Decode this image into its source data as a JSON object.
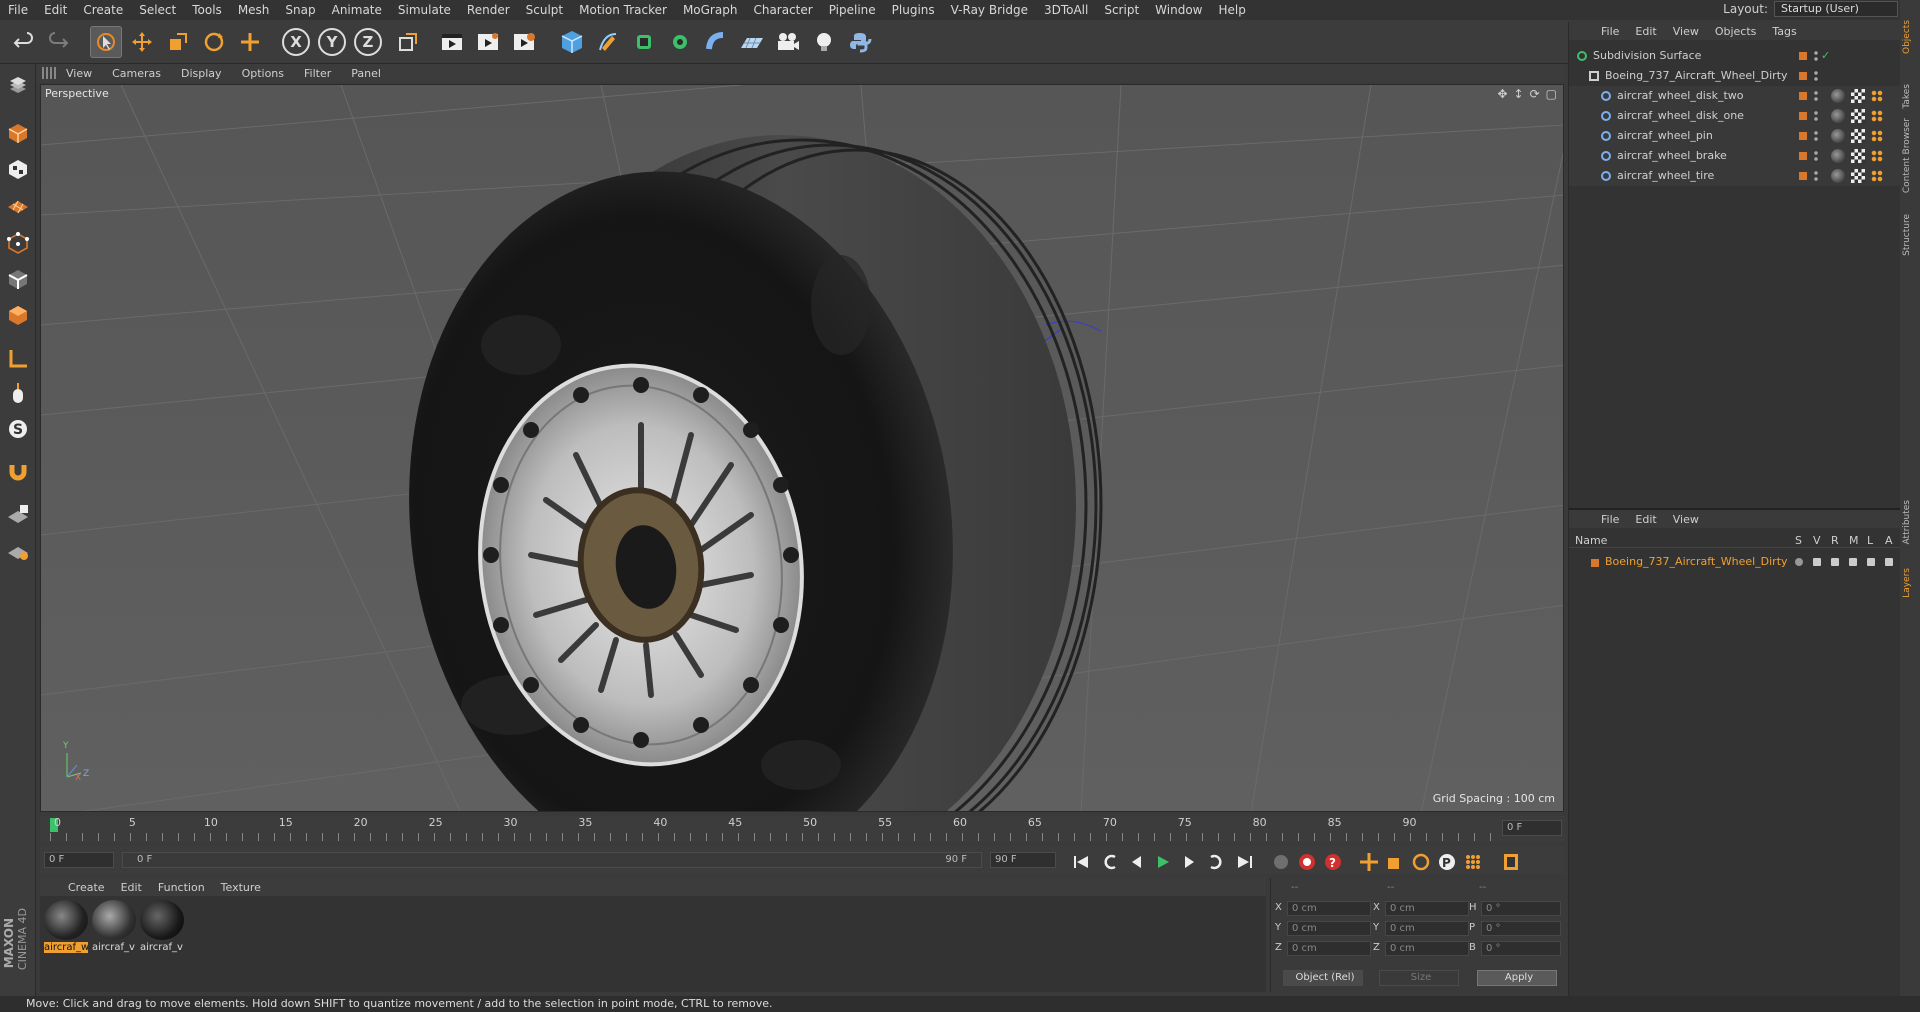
{
  "menu": [
    "File",
    "Edit",
    "Create",
    "Select",
    "Tools",
    "Mesh",
    "Snap",
    "Animate",
    "Simulate",
    "Render",
    "Sculpt",
    "Motion Tracker",
    "MoGraph",
    "Character",
    "Pipeline",
    "Plugins",
    "V-Ray Bridge",
    "3DToAll",
    "Script",
    "Window",
    "Help"
  ],
  "layout": {
    "label": "Layout:",
    "value": "Startup (User)"
  },
  "viewport_menu": [
    "View",
    "Cameras",
    "Display",
    "Options",
    "Filter",
    "Panel"
  ],
  "viewport": {
    "label": "Perspective",
    "grid_spacing": "Grid Spacing : 100 cm",
    "axis_y": "Y",
    "axis_z": "Z",
    "axis_x": "X"
  },
  "timeline": {
    "ticks": [
      "0",
      "5",
      "10",
      "15",
      "20",
      "25",
      "30",
      "35",
      "40",
      "45",
      "50",
      "55",
      "60",
      "65",
      "70",
      "75",
      "80",
      "85",
      "90"
    ],
    "current_frame": "0 F"
  },
  "transport": {
    "start": "0 F",
    "range_start": "0 F",
    "range_end": "90 F",
    "end": "90 F"
  },
  "material_menu": [
    "Create",
    "Edit",
    "Function",
    "Texture"
  ],
  "materials": [
    {
      "label": "aircraf_w",
      "selected": true
    },
    {
      "label": "aircraf_v",
      "selected": false
    },
    {
      "label": "aircraf_v",
      "selected": false
    }
  ],
  "coords": {
    "header": [
      "--",
      "--",
      "--"
    ],
    "rows": [
      {
        "a": "X",
        "av": "0 cm",
        "b": "X",
        "bv": "0 cm",
        "c": "H",
        "cv": "0 °"
      },
      {
        "a": "Y",
        "av": "0 cm",
        "b": "Y",
        "bv": "0 cm",
        "c": "P",
        "cv": "0 °"
      },
      {
        "a": "Z",
        "av": "0 cm",
        "b": "Z",
        "bv": "0 cm",
        "c": "B",
        "cv": "0 °"
      }
    ],
    "mode": "Object (Rel)",
    "size": "Size",
    "apply": "Apply"
  },
  "object_menu": [
    "File",
    "Edit",
    "View",
    "Objects",
    "Tags"
  ],
  "objects": [
    {
      "name": "Subdivision Surface",
      "indent": 0
    },
    {
      "name": "Boeing_737_Aircraft_Wheel_Dirty",
      "indent": 1
    },
    {
      "name": "aircraf_wheel_disk_two",
      "indent": 2
    },
    {
      "name": "aircraf_wheel_disk_one",
      "indent": 2
    },
    {
      "name": "aircraf_wheel_pin",
      "indent": 2
    },
    {
      "name": "aircraf_wheel_brake",
      "indent": 2
    },
    {
      "name": "aircraf_wheel_tire",
      "indent": 2
    }
  ],
  "layer_menu": [
    "File",
    "Edit",
    "View"
  ],
  "layer_header": {
    "name": "Name",
    "cols": [
      "S",
      "V",
      "R",
      "M",
      "L",
      "A"
    ]
  },
  "layers": [
    {
      "name": "Boeing_737_Aircraft_Wheel_Dirty"
    }
  ],
  "right_tabs": [
    "Objects",
    "Takes",
    "Content Browser",
    "Structure",
    "Attributes",
    "Layers"
  ],
  "status": "Move: Click and drag to move elements. Hold down SHIFT to quantize movement / add to the selection in point mode, CTRL to remove.",
  "brand": {
    "maxon": "MAXON",
    "product": "CINEMA 4D"
  },
  "colors": {
    "accent": "#d9772b",
    "selection_orange": "#f0a030",
    "viewport_bg": "#5b5b5b"
  }
}
